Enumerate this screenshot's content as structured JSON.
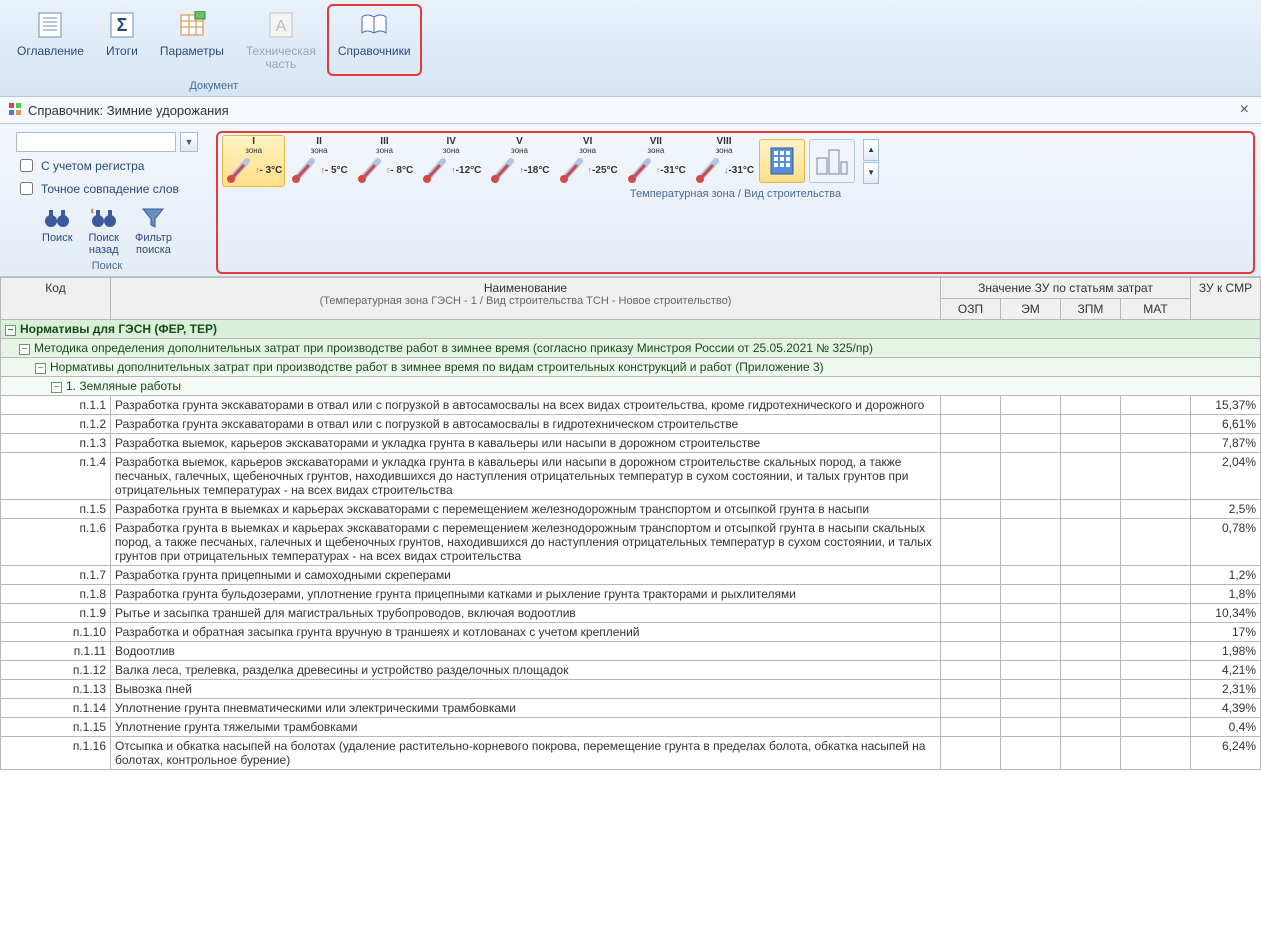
{
  "ribbon": {
    "group_caption": "Документ",
    "items": [
      {
        "label": "Оглавление"
      },
      {
        "label": "Итоги"
      },
      {
        "label": "Параметры"
      },
      {
        "label": "Техническая\nчасть"
      },
      {
        "label": "Справочники"
      }
    ]
  },
  "spr": {
    "title": "Справочник: Зимние удорожания"
  },
  "search": {
    "value": "",
    "case_label": "С учетом регистра",
    "exact_label": "Точное совпадение слов",
    "group_caption": "Поиск",
    "btn_search": "Поиск",
    "btn_search_back": "Поиск\nназад",
    "btn_filter": "Фильтр\nпоиска"
  },
  "zones": {
    "caption": "Температурная зона / Вид строительства",
    "items": [
      {
        "label": "I",
        "sub": "зона",
        "temp": "- 3°C",
        "arrow": "↑"
      },
      {
        "label": "II",
        "sub": "зона",
        "temp": "- 5°C",
        "arrow": "↑"
      },
      {
        "label": "III",
        "sub": "зона",
        "temp": "- 8°C",
        "arrow": "↑"
      },
      {
        "label": "IV",
        "sub": "зона",
        "temp": "-12°C",
        "arrow": "↑"
      },
      {
        "label": "V",
        "sub": "зона",
        "temp": "-18°C",
        "arrow": "↑"
      },
      {
        "label": "VI",
        "sub": "зона",
        "temp": "-25°C",
        "arrow": "↑"
      },
      {
        "label": "VII",
        "sub": "зона",
        "temp": "-31°C",
        "arrow": "↑"
      },
      {
        "label": "VIII",
        "sub": "зона",
        "temp": "-31°C",
        "arrow": "↓"
      }
    ]
  },
  "table": {
    "hdr_code": "Код",
    "hdr_name": "Наименование",
    "hdr_name_sub": "(Температурная зона ГЭСН - 1  / Вид строительства ТСН - Новое строительство)",
    "hdr_zu_group": "Значение ЗУ по статьям затрат",
    "hdr_ozp": "ОЗП",
    "hdr_em": "ЭМ",
    "hdr_zpm": "ЗПМ",
    "hdr_mat": "МАТ",
    "hdr_zusmr": "ЗУ к СМР",
    "group0": "Нормативы для ГЭСН (ФЕР, ТЕР)",
    "group1": "Методика определения дополнительных затрат при производстве работ в зимнее время (согласно приказу Минстроя России от 25.05.2021 № 325/пр)",
    "group2": "Нормативы дополнительных затрат при производстве работ в зимнее время по видам строительных конструкций и работ (Приложение 3)",
    "group3": "1. Земляные работы",
    "rows": [
      {
        "code": "п.1.1",
        "name": "Разработка грунта экскаваторами в отвал или с погрузкой в автосамосвалы на всех видах строительства, кроме гидротехнического и дорожного",
        "zu": "15,37%"
      },
      {
        "code": "п.1.2",
        "name": "Разработка грунта экскаваторами в отвал или с погрузкой в автосамосвалы в гидротехническом строительстве",
        "zu": "6,61%"
      },
      {
        "code": "п.1.3",
        "name": "Разработка выемок, карьеров экскаваторами и укладка грунта в кавальеры или насыпи в дорожном строительстве",
        "zu": "7,87%"
      },
      {
        "code": "п.1.4",
        "name": "Разработка выемок, карьеров экскаваторами и укладка грунта в кавальеры или насыпи в дорожном строительстве скальных пород, а также песчаных, галечных, щебеночных грунтов, находившихся до наступления отрицательных температур в сухом состоянии, и талых грунтов при отрицательных температурах - на всех видах строительства",
        "zu": "2,04%"
      },
      {
        "code": "п.1.5",
        "name": "Разработка грунта в выемках и карьерах экскаваторами с перемещением железнодорожным транспортом и отсыпкой грунта в насыпи",
        "zu": "2,5%"
      },
      {
        "code": "п.1.6",
        "name": "Разработка грунта в выемках и карьерах экскаваторами с перемещением железнодорожным транспортом и отсыпкой грунта в насыпи скальных пород, а также песчаных, галечных и щебеночных грунтов, находившихся до наступления отрицательных температур в сухом состоянии, и талых грунтов при отрицательных температурах - на всех видах строительства",
        "zu": "0,78%"
      },
      {
        "code": "п.1.7",
        "name": "Разработка грунта прицепными и самоходными скреперами",
        "zu": "1,2%"
      },
      {
        "code": "п.1.8",
        "name": "Разработка грунта бульдозерами, уплотнение грунта прицепными катками и рыхление грунта тракторами и рыхлителями",
        "zu": "1,8%"
      },
      {
        "code": "п.1.9",
        "name": "Рытье и засыпка траншей для магистральных трубопроводов, включая водоотлив",
        "zu": "10,34%"
      },
      {
        "code": "п.1.10",
        "name": "Разработка и обратная засыпка грунта вручную в траншеях и котлованах с учетом креплений",
        "zu": "17%"
      },
      {
        "code": "п.1.11",
        "name": "Водоотлив",
        "zu": "1,98%"
      },
      {
        "code": "п.1.12",
        "name": "Валка леса, трелевка, разделка древесины и устройство разделочных площадок",
        "zu": "4,21%"
      },
      {
        "code": "п.1.13",
        "name": "Вывозка пней",
        "zu": "2,31%"
      },
      {
        "code": "п.1.14",
        "name": "Уплотнение грунта пневматическими или электрическими трамбовками",
        "zu": "4,39%"
      },
      {
        "code": "п.1.15",
        "name": "Уплотнение грунта тяжелыми трамбовками",
        "zu": "0,4%"
      },
      {
        "code": "п.1.16",
        "name": "Отсыпка и обкатка насыпей на болотах (удаление растительно-корневого покрова, перемещение грунта в пределах болота, обкатка насыпей на болотах, контрольное бурение)",
        "zu": "6,24%"
      }
    ]
  }
}
